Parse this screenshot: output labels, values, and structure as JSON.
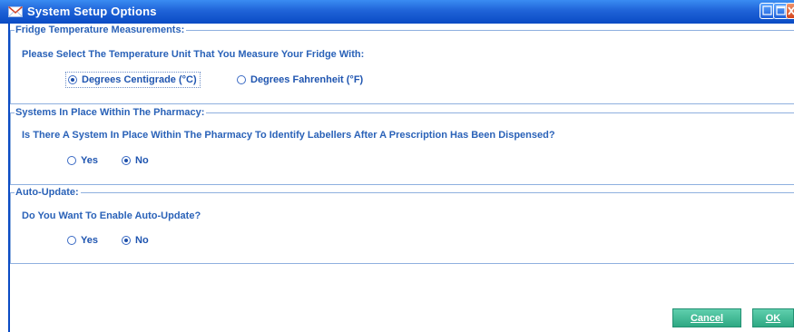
{
  "window": {
    "title": "System Setup Options",
    "title_icon": "envelope-icon",
    "controls": [
      "minimize-icon",
      "maximize-icon",
      "close-icon"
    ],
    "colors": {
      "titlebar": "#1f63d8",
      "text": "#2a62b8",
      "button": "#2ea883"
    }
  },
  "fridge": {
    "group_title": "Fridge Temperature Measurements:",
    "question": "Please Select The Temperature Unit That You Measure Your Fridge With:",
    "options": [
      {
        "label": "Degrees Centigrade (°C)",
        "checked": true
      },
      {
        "label": "Degrees Fahrenheit (°F)",
        "checked": false
      }
    ]
  },
  "systems": {
    "group_title": "Systems In Place Within The Pharmacy:",
    "question": "Is There A System In Place Within The Pharmacy To Identify Labellers After A Prescription Has Been Dispensed?",
    "options": [
      {
        "label": "Yes",
        "checked": false
      },
      {
        "label": "No",
        "checked": true
      }
    ]
  },
  "autoupdate": {
    "group_title": "Auto-Update:",
    "question": "Do You Want To Enable Auto-Update?",
    "options": [
      {
        "label": "Yes",
        "checked": false
      },
      {
        "label": "No",
        "checked": true
      }
    ]
  },
  "buttons": {
    "cancel": "Cancel",
    "ok": "OK"
  }
}
